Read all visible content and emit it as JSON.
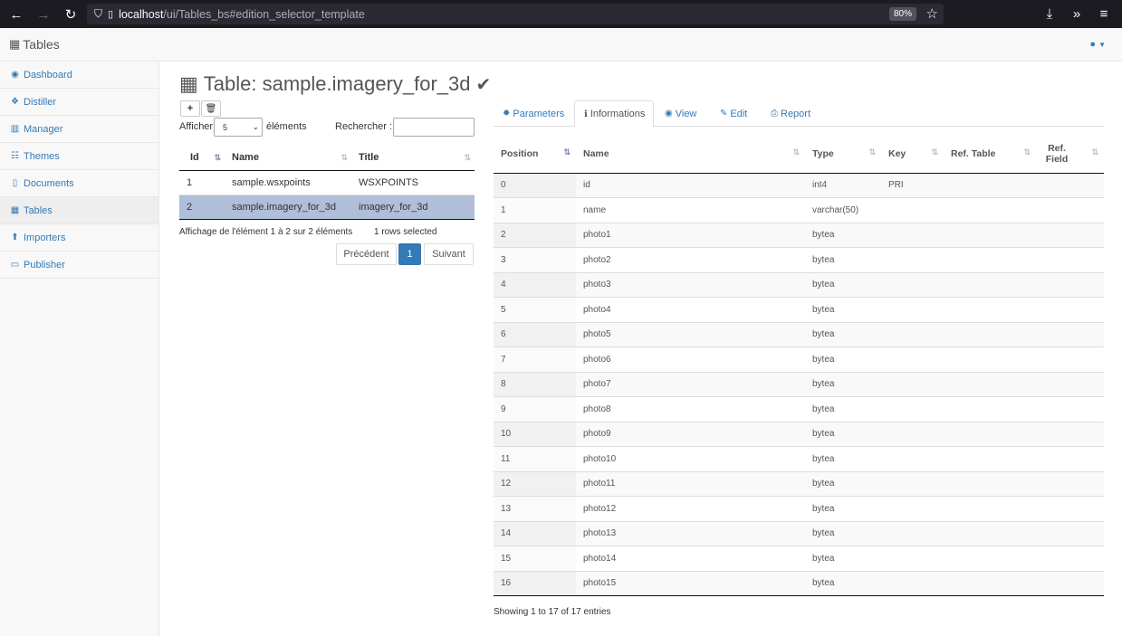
{
  "browser": {
    "url_host": "localhost",
    "url_path": "/ui/Tables_bs#edition_selector_template",
    "zoom": "80%"
  },
  "app": {
    "brand": "Tables"
  },
  "sidebar": {
    "items": [
      {
        "label": "Dashboard",
        "icon": "dashboard-icon",
        "glyph": "◉"
      },
      {
        "label": "Distiller",
        "icon": "cubes-icon",
        "glyph": "❖"
      },
      {
        "label": "Manager",
        "icon": "map-icon",
        "glyph": "▥"
      },
      {
        "label": "Themes",
        "icon": "list-icon",
        "glyph": "☷"
      },
      {
        "label": "Documents",
        "icon": "file-icon",
        "glyph": "▯"
      },
      {
        "label": "Tables",
        "icon": "table-icon",
        "glyph": "▦"
      },
      {
        "label": "Importers",
        "icon": "upload-icon",
        "glyph": "⬆"
      },
      {
        "label": "Publisher",
        "icon": "laptop-icon",
        "glyph": "▭"
      }
    ]
  },
  "main": {
    "title": "Table: sample.imagery_for_3d",
    "show_label": "Afficher",
    "page_size": "5",
    "elements_label": "éléments",
    "search_label": "Rechercher :",
    "left_table": {
      "columns": [
        "Id",
        "Name",
        "Title"
      ],
      "rows": [
        {
          "id": "1",
          "name": "sample.wsxpoints",
          "title": "WSXPOINTS",
          "selected": false
        },
        {
          "id": "2",
          "name": "sample.imagery_for_3d",
          "title": "imagery_for_3d",
          "selected": true
        }
      ]
    },
    "info": "Affichage de l'élément 1 à 2 sur 2 éléments",
    "selection_info": "1 rows selected",
    "pager": {
      "prev": "Précédent",
      "page": "1",
      "next": "Suivant"
    }
  },
  "tabs": [
    {
      "label": "Parameters",
      "icon": "gear-icon",
      "glyph": "✹"
    },
    {
      "label": "Informations",
      "icon": "info-icon",
      "glyph": "ℹ"
    },
    {
      "label": "View",
      "icon": "eye-icon",
      "glyph": "◉"
    },
    {
      "label": "Edit",
      "icon": "edit-icon",
      "glyph": "✎"
    },
    {
      "label": "Report",
      "icon": "print-icon",
      "glyph": "⎙"
    }
  ],
  "fields_table": {
    "columns": [
      "Position",
      "Name",
      "Type",
      "Key",
      "Ref. Table",
      "Ref. Field"
    ],
    "rows": [
      [
        "0",
        "id",
        "int4",
        "PRI",
        "",
        ""
      ],
      [
        "1",
        "name",
        "varchar(50)",
        "",
        "",
        ""
      ],
      [
        "2",
        "photo1",
        "bytea",
        "",
        "",
        ""
      ],
      [
        "3",
        "photo2",
        "bytea",
        "",
        "",
        ""
      ],
      [
        "4",
        "photo3",
        "bytea",
        "",
        "",
        ""
      ],
      [
        "5",
        "photo4",
        "bytea",
        "",
        "",
        ""
      ],
      [
        "6",
        "photo5",
        "bytea",
        "",
        "",
        ""
      ],
      [
        "7",
        "photo6",
        "bytea",
        "",
        "",
        ""
      ],
      [
        "8",
        "photo7",
        "bytea",
        "",
        "",
        ""
      ],
      [
        "9",
        "photo8",
        "bytea",
        "",
        "",
        ""
      ],
      [
        "10",
        "photo9",
        "bytea",
        "",
        "",
        ""
      ],
      [
        "11",
        "photo10",
        "bytea",
        "",
        "",
        ""
      ],
      [
        "12",
        "photo11",
        "bytea",
        "",
        "",
        ""
      ],
      [
        "13",
        "photo12",
        "bytea",
        "",
        "",
        ""
      ],
      [
        "14",
        "photo13",
        "bytea",
        "",
        "",
        ""
      ],
      [
        "15",
        "photo14",
        "bytea",
        "",
        "",
        ""
      ],
      [
        "16",
        "photo15",
        "bytea",
        "",
        "",
        ""
      ]
    ],
    "footer": "Showing 1 to 17 of 17 entries"
  }
}
